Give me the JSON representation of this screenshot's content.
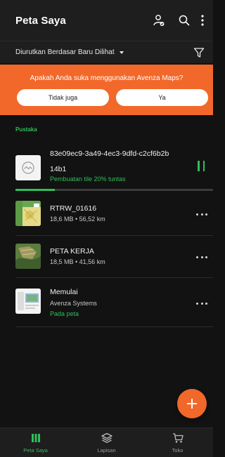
{
  "appbar": {
    "title": "Peta Saya",
    "icons": [
      "user-check-icon",
      "search-icon",
      "more-vert-icon"
    ]
  },
  "sort": {
    "label": "Diurutkan Berdasar Baru Dilihat",
    "icons": [
      "caret-down-icon",
      "filter-icon"
    ]
  },
  "banner": {
    "question": "Apakah Anda suka menggunakan Avenza Maps?",
    "no_label": "Tidak juga",
    "yes_label": "Ya",
    "color": "#f2682a"
  },
  "library": {
    "section_label": "Pustaka",
    "items": [
      {
        "name_line1": "83e09ec9-3a49-4ec3-9dfd-c2cf6b2b",
        "name_line2": "14b1",
        "status": "Pembuatan tile 20% tuntas",
        "progress": 0.2,
        "icon": "map-placeholder-icon"
      },
      {
        "name": "RTRW_01616",
        "info": "18,6 MB • 56,52 km",
        "icon": "map-thumbnail"
      },
      {
        "name": "PETA KERJA",
        "info": "18,5 MB • 41,56 km",
        "icon": "map-thumbnail"
      },
      {
        "name": "Memulai",
        "info": "Avenza Systems",
        "status": "Pada peta",
        "icon": "map-thumbnail"
      }
    ]
  },
  "fab": {
    "icon": "plus-icon"
  },
  "bottom_nav": [
    {
      "label": "Peta Saya",
      "icon": "library-icon",
      "active": true
    },
    {
      "label": "Lapisan",
      "icon": "layers-icon",
      "active": false
    },
    {
      "label": "Toko",
      "icon": "cart-icon",
      "active": false
    }
  ],
  "colors": {
    "accent": "#f2682a",
    "green": "#2fbf5b",
    "background": "#121212"
  }
}
